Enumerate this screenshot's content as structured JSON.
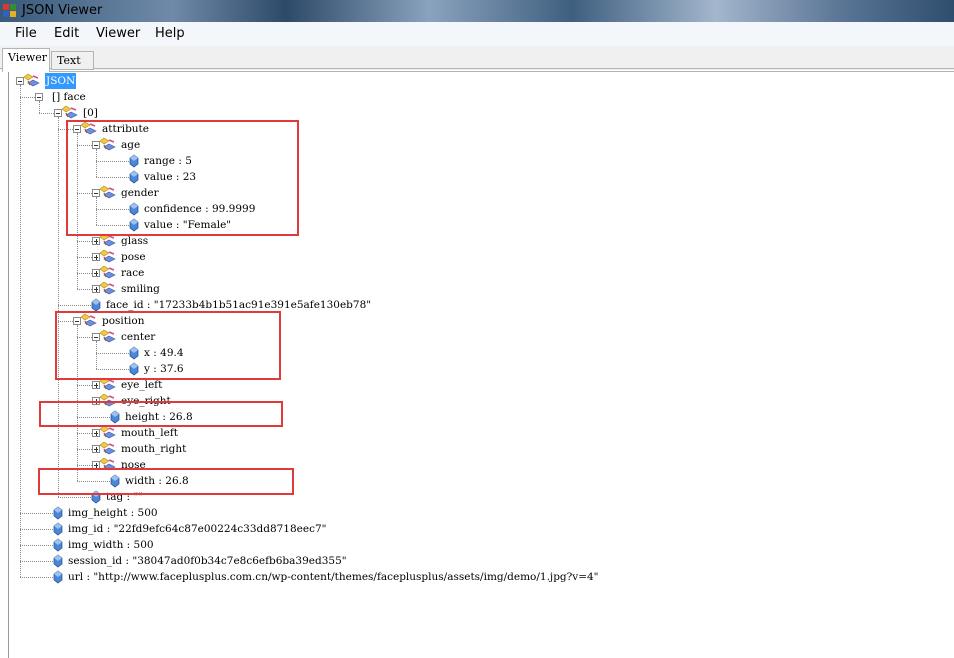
{
  "window": {
    "title": "JSON Viewer"
  },
  "menu": [
    "File",
    "Edit",
    "Viewer",
    "Help"
  ],
  "tabs": [
    "Viewer",
    "Text"
  ],
  "tree": {
    "root": "JSON",
    "face": "[] face",
    "item0": "[0]",
    "attribute": "attribute",
    "age": "age",
    "age_range": "range : 5",
    "age_value": "value : 23",
    "gender": "gender",
    "gender_confidence": "confidence : 99.9999",
    "gender_value": "value : \"Female\"",
    "glass": "glass",
    "pose": "pose",
    "race": "race",
    "smiling": "smiling",
    "face_id": "face_id : \"17233b4b1b51ac91e391e5afe130eb78\"",
    "position": "position",
    "center": "center",
    "center_x": "x : 49.4",
    "center_y": "y : 37.6",
    "eye_left": "eye_left",
    "eye_right": "eye_right",
    "height": "height : 26.8",
    "mouth_left": "mouth_left",
    "mouth_right": "mouth_right",
    "nose": "nose",
    "width": "width : 26.8",
    "tag": "tag : \"\"",
    "img_height": "img_height : 500",
    "img_id": "img_id : \"22fd9efc64c87e00224c33dd8718eec7\"",
    "img_width": "img_width : 500",
    "session_id": "session_id : \"38047ad0f0b34c7e8c6efb6ba39ed355\"",
    "url": "url : \"http://www.faceplusplus.com.cn/wp-content/themes/faceplusplus/assets/img/demo/1.jpg?v=4\""
  },
  "colors": {
    "highlight_box": "#e03a3a",
    "selection": "#3399ff"
  }
}
